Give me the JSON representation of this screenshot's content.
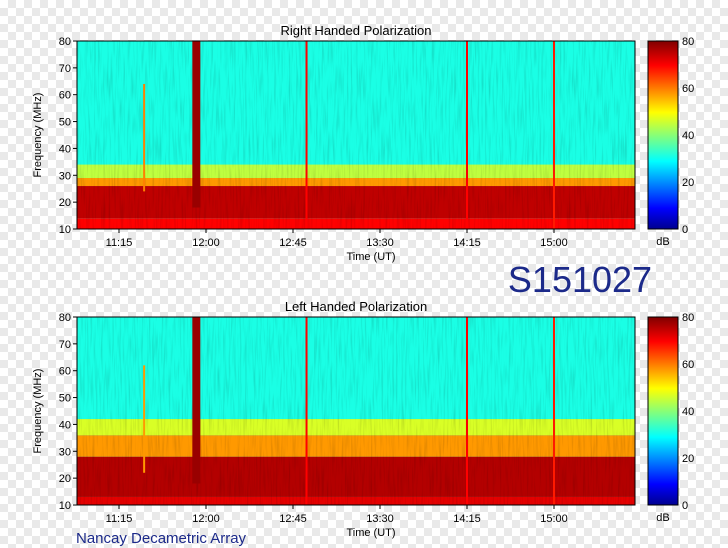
{
  "observation_id": "S151027",
  "instrument": "Nancay Decametric Array",
  "chart_data": [
    {
      "type": "heatmap",
      "title": "Right Handed Polarization",
      "xlabel": "Time (UT)",
      "ylabel": "Frequency (MHz)",
      "x_ticks": [
        "11:15",
        "12:00",
        "12:45",
        "13:30",
        "14:15",
        "15:00"
      ],
      "y_ticks": [
        10,
        20,
        30,
        40,
        50,
        60,
        70,
        80
      ],
      "ylim": [
        10,
        80
      ],
      "colorbar": {
        "label": "dB",
        "ticks": [
          0,
          20,
          40,
          60,
          80
        ],
        "range": [
          0,
          80
        ]
      },
      "features": {
        "background_db": [
          {
            "freq_from": 10,
            "freq_to": 14,
            "db": 70
          },
          {
            "freq_from": 14,
            "freq_to": 26,
            "db": 75
          },
          {
            "freq_from": 26,
            "freq_to": 29,
            "db": 58
          },
          {
            "freq_from": 29,
            "freq_to": 34,
            "db": 45
          },
          {
            "freq_from": 34,
            "freq_to": 80,
            "db": 32
          }
        ],
        "bursts": [
          {
            "time": "11:55",
            "freq_from": 18,
            "freq_to": 80,
            "db": 78
          },
          {
            "time": "11:28",
            "freq_from": 24,
            "freq_to": 64,
            "db": 60
          },
          {
            "time": "12:52",
            "freq_from": 10,
            "freq_to": 80,
            "db": 70
          },
          {
            "time": "14:15",
            "freq_from": 10,
            "freq_to": 80,
            "db": 70
          },
          {
            "time": "15:00",
            "freq_from": 10,
            "freq_to": 80,
            "db": 68
          }
        ]
      }
    },
    {
      "type": "heatmap",
      "title": "Left Handed Polarization",
      "xlabel": "Time (UT)",
      "ylabel": "Frequency (MHz)",
      "x_ticks": [
        "11:15",
        "12:00",
        "12:45",
        "13:30",
        "14:15",
        "15:00"
      ],
      "y_ticks": [
        10,
        20,
        30,
        40,
        50,
        60,
        70,
        80
      ],
      "ylim": [
        10,
        80
      ],
      "colorbar": {
        "label": "dB",
        "ticks": [
          0,
          20,
          40,
          60,
          80
        ],
        "range": [
          0,
          80
        ]
      },
      "features": {
        "background_db": [
          {
            "freq_from": 10,
            "freq_to": 13,
            "db": 72
          },
          {
            "freq_from": 13,
            "freq_to": 28,
            "db": 76
          },
          {
            "freq_from": 28,
            "freq_to": 36,
            "db": 58
          },
          {
            "freq_from": 36,
            "freq_to": 42,
            "db": 47
          },
          {
            "freq_from": 42,
            "freq_to": 80,
            "db": 32
          }
        ],
        "bursts": [
          {
            "time": "11:55",
            "freq_from": 18,
            "freq_to": 80,
            "db": 78
          },
          {
            "time": "11:28",
            "freq_from": 22,
            "freq_to": 62,
            "db": 58
          },
          {
            "time": "12:52",
            "freq_from": 10,
            "freq_to": 80,
            "db": 70
          },
          {
            "time": "14:15",
            "freq_from": 10,
            "freq_to": 80,
            "db": 70
          },
          {
            "time": "15:00",
            "freq_from": 10,
            "freq_to": 80,
            "db": 68
          }
        ]
      }
    }
  ]
}
